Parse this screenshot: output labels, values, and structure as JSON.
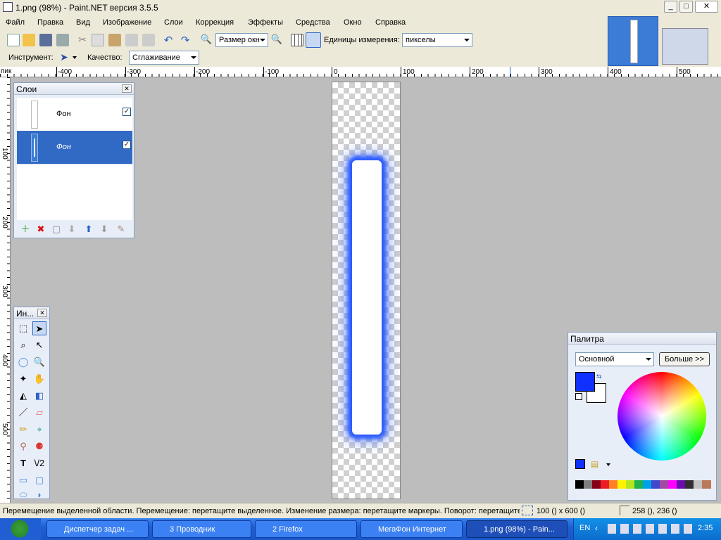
{
  "window": {
    "title": "1.png (98%) - Paint.NET версия 3.5.5",
    "minimize": "_",
    "maximize": "□",
    "close": "✕"
  },
  "menu": [
    "Файл",
    "Правка",
    "Вид",
    "Изображение",
    "Слои",
    "Коррекция",
    "Эффекты",
    "Средства",
    "Окно",
    "Справка"
  ],
  "toolbar": {
    "zoom_value": "Размер окн",
    "units_label": "Единицы измерения:",
    "units_value": "пикселы",
    "tool_label": "Инструмент:",
    "quality_label": "Качество:",
    "quality_value": "Сглаживание"
  },
  "ruler": {
    "unit": "пик",
    "top_labels": [
      "-400",
      "-300",
      "-200",
      "-100",
      "0",
      "100",
      "200",
      "300",
      "400",
      "500"
    ],
    "left_labels": [
      "100",
      "200",
      "300",
      "400",
      "500"
    ]
  },
  "layers_panel": {
    "title": "Слои",
    "layers": [
      {
        "name": "Фон",
        "checked": true,
        "selected": false
      },
      {
        "name": "Фон",
        "checked": true,
        "selected": true
      }
    ],
    "check_mark": "✓"
  },
  "tools_panel": {
    "title": "Ин..."
  },
  "palette_panel": {
    "title": "Палитра",
    "mode_value": "Основной",
    "more_button": "Больше >>",
    "primary_color": "#1030ff",
    "secondary_color": "#ffffff",
    "swatches": [
      "#000000",
      "#7f7f7f",
      "#880015",
      "#ed1c24",
      "#ff7f27",
      "#fff200",
      "#b5e61d",
      "#22b14c",
      "#00a2e8",
      "#3f48cc",
      "#a349a4",
      "#ff00ff",
      "#6a0dad",
      "#2f2f2f",
      "#c3c3c3",
      "#b97a57"
    ]
  },
  "status": {
    "message": "Перемещение выделенной области. Перемещение: перетащите выделенное. Изменение размера: перетащите маркеры. Поворот: перетащите",
    "size": "100 () x 600 ()",
    "cursor": "258 (), 236 ()"
  },
  "taskbar": {
    "items": [
      "Диспетчер задач ...",
      "3 Проводник",
      "2 Firefox",
      "МегаФон Интернет",
      "1.png (98%) - Pain..."
    ],
    "lang": "EN",
    "clock": "2:35"
  }
}
